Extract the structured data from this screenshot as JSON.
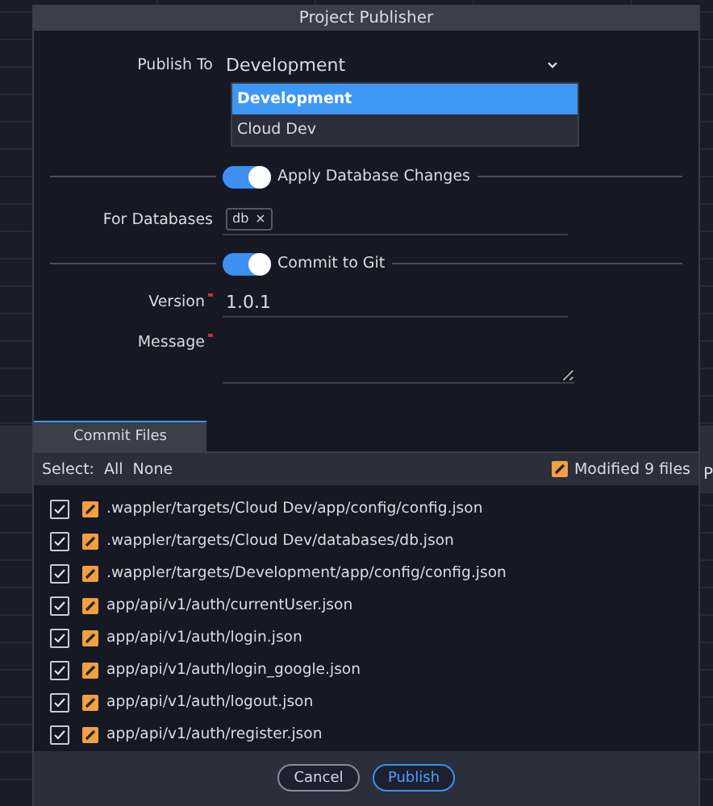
{
  "window": {
    "title": "Project Publisher"
  },
  "publish_to": {
    "label": "Publish To",
    "value": "Development",
    "expanded": true,
    "options": [
      {
        "label": "Development",
        "selected": true
      },
      {
        "label": "Cloud Dev",
        "selected": false
      }
    ]
  },
  "apply_db": {
    "label": "Apply Database Changes",
    "on": true
  },
  "for_databases": {
    "label": "For Databases",
    "tags": [
      {
        "label": "db",
        "remove": "×"
      }
    ]
  },
  "commit_git": {
    "label": "Commit to Git",
    "on": true
  },
  "version": {
    "label": "Version",
    "required": true,
    "value": "1.0.1"
  },
  "message": {
    "label": "Message",
    "required": true
  },
  "tabs": [
    {
      "label": "Commit Files",
      "selected": true
    }
  ],
  "select_bar": {
    "label": "Select:",
    "all": "All",
    "none": "None",
    "modified": "Modified 9 files",
    "cut_text": "P"
  },
  "files": [
    {
      "path": ".wappler/targets/Cloud Dev/app/config/config.json",
      "checked": true
    },
    {
      "path": ".wappler/targets/Cloud Dev/databases/db.json",
      "checked": true
    },
    {
      "path": ".wappler/targets/Development/app/config/config.json",
      "checked": true
    },
    {
      "path": "app/api/v1/auth/currentUser.json",
      "checked": true
    },
    {
      "path": "app/api/v1/auth/login.json",
      "checked": true
    },
    {
      "path": "app/api/v1/auth/login_google.json",
      "checked": true
    },
    {
      "path": "app/api/v1/auth/logout.json",
      "checked": true
    },
    {
      "path": "app/api/v1/auth/register.json",
      "checked": true
    }
  ],
  "buttons": [
    {
      "label": "Cancel",
      "kind": "secondary"
    },
    {
      "label": "Publish",
      "kind": "primary"
    }
  ]
}
